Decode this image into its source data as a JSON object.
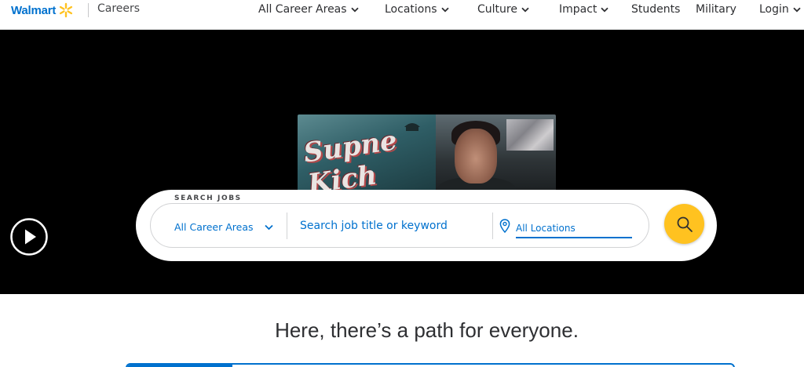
{
  "header": {
    "brand": "Walmart",
    "section": "Careers",
    "nav": [
      {
        "label": "All Career Areas",
        "has_dropdown": true
      },
      {
        "label": "Locations",
        "has_dropdown": true
      },
      {
        "label": "Culture",
        "has_dropdown": true
      },
      {
        "label": "Impact",
        "has_dropdown": true
      },
      {
        "label": "Students",
        "has_dropdown": false
      },
      {
        "label": "Military",
        "has_dropdown": false
      },
      {
        "label": "Login",
        "has_dropdown": true
      }
    ]
  },
  "hero": {
    "video_thumbnail_title": "Supne Kich",
    "play_icon": "play-icon"
  },
  "search": {
    "label": "SEARCH JOBS",
    "career_area_selected": "All Career Areas",
    "keyword_placeholder": "Search job title or keyword",
    "location_value": "All Locations",
    "button_icon": "search-icon"
  },
  "main": {
    "tagline": "Here, there’s a path for everyone."
  },
  "colors": {
    "brand_blue": "#0071ce",
    "spark_yellow": "#ffc220",
    "hero_bg": "#000000"
  }
}
